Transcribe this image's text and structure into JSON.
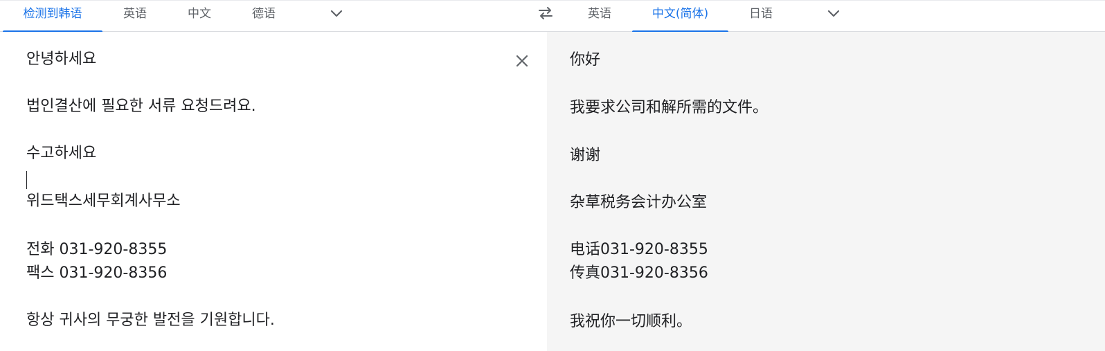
{
  "source_tabs": [
    {
      "label": "检测到韩语",
      "active": true
    },
    {
      "label": "英语",
      "active": false
    },
    {
      "label": "中文",
      "active": false
    },
    {
      "label": "德语",
      "active": false
    }
  ],
  "target_tabs": [
    {
      "label": "英语",
      "active": false
    },
    {
      "label": "中文(简体)",
      "active": true
    },
    {
      "label": "日语",
      "active": false
    }
  ],
  "icons": {
    "source_more": "chevron-down-icon",
    "swap": "swap-languages-icon",
    "target_more": "chevron-down-icon",
    "clear": "close-icon"
  },
  "colors": {
    "accent": "#1a73e8",
    "text": "#202124",
    "muted": "#5f6368",
    "target_bg": "#f5f5f5"
  },
  "source_text": [
    "안녕하세요",
    "",
    "법인결산에 필요한 서류 요청드려요.",
    "",
    "수고하세요",
    "",
    "위드택스세무회계사무소",
    "",
    "전화 031-920-8355",
    "팩스 031-920-8356",
    "",
    "항상 귀사의 무궁한 발전을 기원합니다."
  ],
  "target_text": [
    "你好",
    "",
    "我要求公司和解所需的文件。",
    "",
    "谢谢",
    "",
    "杂草税务会计办公室",
    "",
    "电话031-920-8355",
    "传真031-920-8356",
    "",
    "我祝你一切顺利。"
  ]
}
